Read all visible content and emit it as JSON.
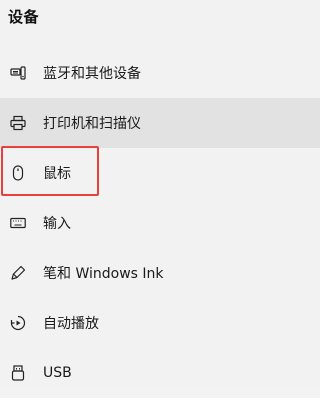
{
  "header": {
    "title": "设备"
  },
  "nav": {
    "items": [
      {
        "label": "蓝牙和其他设备",
        "icon": "bluetooth-devices-icon"
      },
      {
        "label": "打印机和扫描仪",
        "icon": "printer-icon"
      },
      {
        "label": "鼠标",
        "icon": "mouse-icon"
      },
      {
        "label": "输入",
        "icon": "keyboard-icon"
      },
      {
        "label": "笔和 Windows Ink",
        "icon": "pen-icon"
      },
      {
        "label": "自动播放",
        "icon": "autoplay-icon"
      },
      {
        "label": "USB",
        "icon": "usb-icon"
      }
    ]
  },
  "colors": {
    "background": "#f2f2f2",
    "hover_row": "#e2e2e2",
    "annotation_box": "#e8413b",
    "text": "#1a1a1a"
  }
}
